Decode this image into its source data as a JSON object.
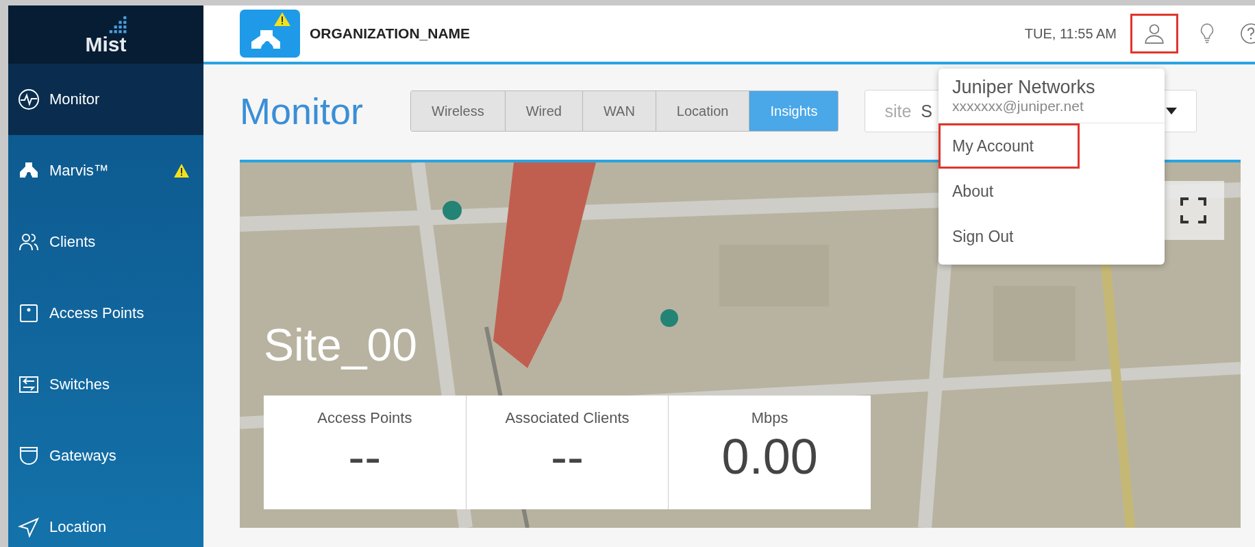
{
  "sidebar": {
    "logo": "Mist",
    "items": [
      {
        "label": "Monitor",
        "selected": true,
        "warning": false
      },
      {
        "label": "Marvis™",
        "selected": false,
        "warning": true
      },
      {
        "label": "Clients",
        "selected": false,
        "warning": false
      },
      {
        "label": "Access Points",
        "selected": false,
        "warning": false
      },
      {
        "label": "Switches",
        "selected": false,
        "warning": false
      },
      {
        "label": "Gateways",
        "selected": false,
        "warning": false
      },
      {
        "label": "Location",
        "selected": false,
        "warning": false
      }
    ]
  },
  "header": {
    "org_name": "ORGANIZATION_NAME",
    "time": "TUE, 11:55 AM",
    "user_button": {
      "highlighted": true
    }
  },
  "page": {
    "title": "Monitor",
    "tabs": [
      {
        "label": "Wireless",
        "selected": false
      },
      {
        "label": "Wired",
        "selected": false
      },
      {
        "label": "WAN",
        "selected": false
      },
      {
        "label": "Location",
        "selected": false
      },
      {
        "label": "Insights",
        "selected": true
      }
    ],
    "site_select": {
      "label": "site",
      "value": "S"
    }
  },
  "map": {
    "site_name": "Site_00",
    "stats": [
      {
        "label": "Access Points",
        "value": "--"
      },
      {
        "label": "Associated Clients",
        "value": "--"
      },
      {
        "label": "Mbps",
        "value": "0.00"
      }
    ]
  },
  "user_menu": {
    "name": "Juniper Networks",
    "email": "xxxxxxx@juniper.net",
    "items": [
      {
        "label": "My Account",
        "highlighted": true
      },
      {
        "label": "About",
        "highlighted": false
      },
      {
        "label": "Sign Out",
        "highlighted": false
      }
    ]
  }
}
